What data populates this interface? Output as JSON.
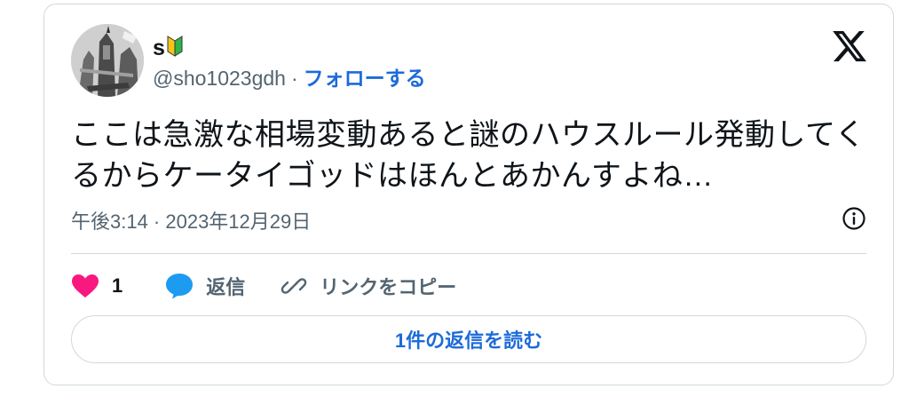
{
  "author": {
    "display_name": "s",
    "badge_icon": "beginner-mark-icon",
    "handle": "@sho1023gdh",
    "separator": "·",
    "follow_label": "フォローする"
  },
  "brand": {
    "logo_icon": "x-logo-icon"
  },
  "tweet": {
    "text": "ここは急激な相場変動あると謎のハウスルール発動してくるからケータイゴッドはほんとあかんすよね…",
    "timestamp": "午後3:14 · 2023年12月29日"
  },
  "actions": {
    "like_count": "1",
    "reply_label": "返信",
    "copy_link_label": "リンクをコピー"
  },
  "footer": {
    "read_replies_label": "1件の返信を読む"
  },
  "colors": {
    "accent": "#1d6bd8",
    "like": "#f91880",
    "reply": "#1d9bf0",
    "text_secondary": "#536471",
    "border": "#cfd9de"
  }
}
